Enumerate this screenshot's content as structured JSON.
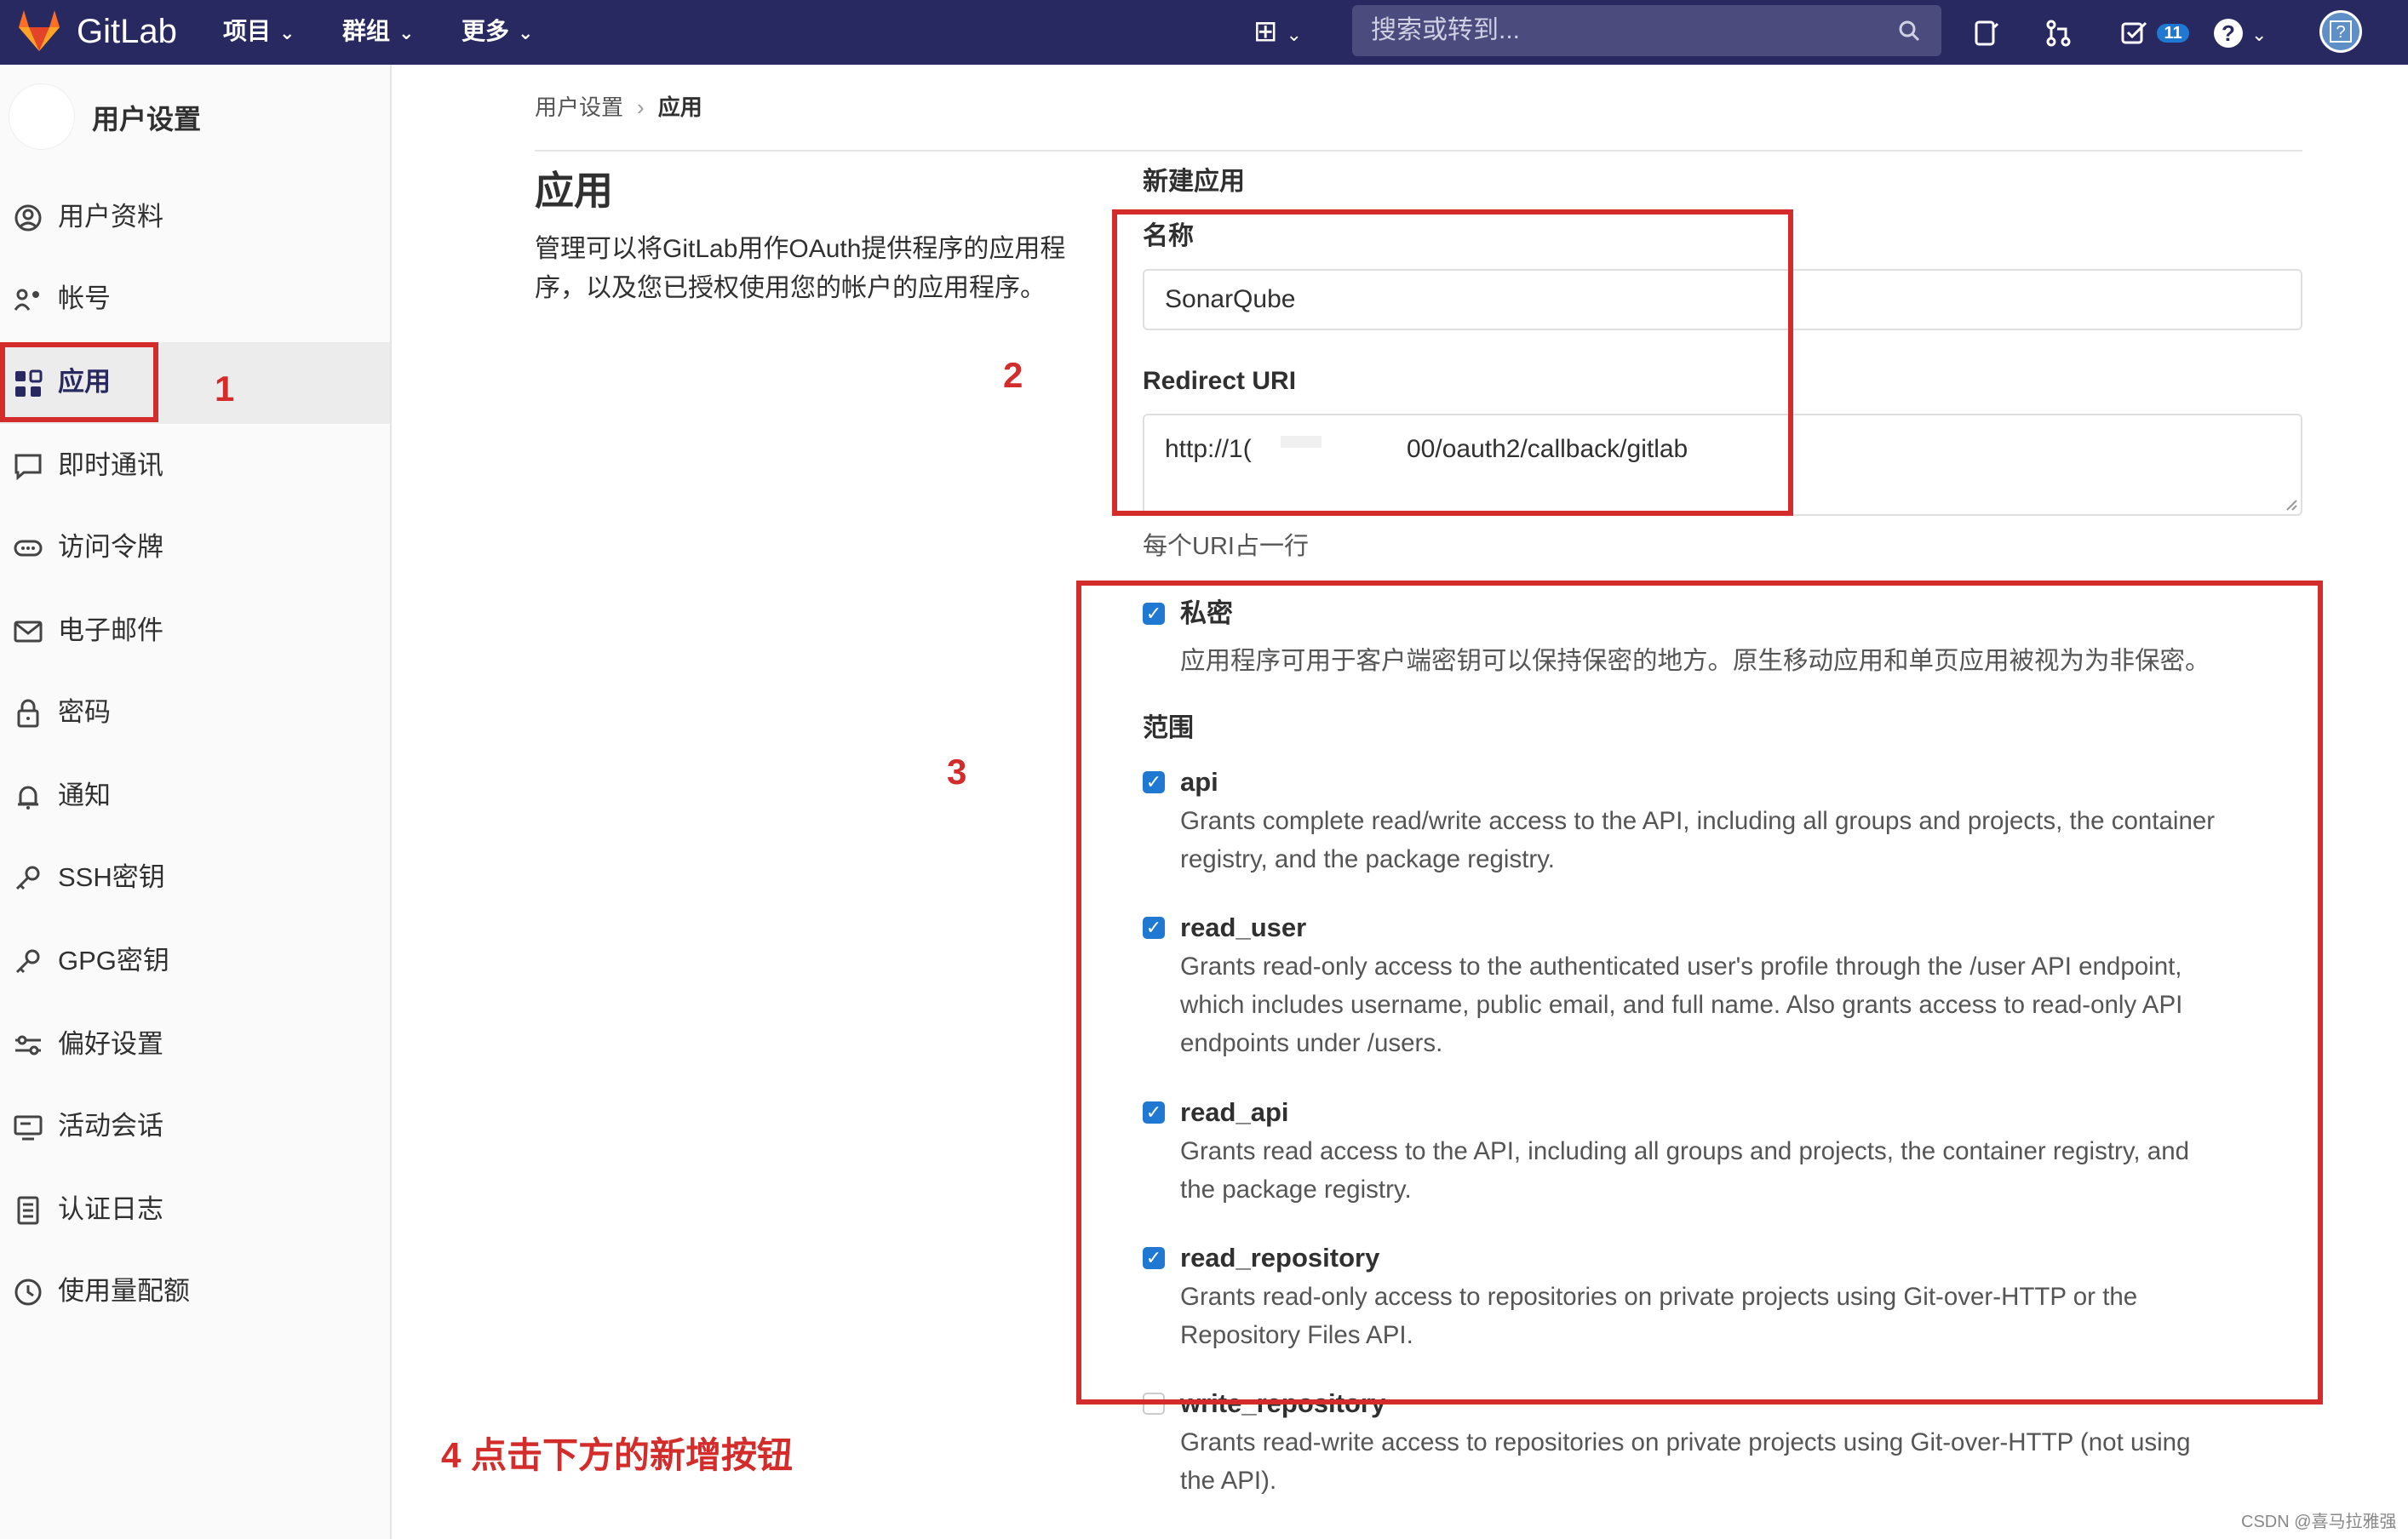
{
  "navbar": {
    "brand": "GitLab",
    "menus": [
      {
        "label": "项目"
      },
      {
        "label": "群组"
      },
      {
        "label": "更多"
      }
    ],
    "search_placeholder": "搜索或转到...",
    "todo_count": "11"
  },
  "sidebar": {
    "title": "用户设置",
    "items": [
      {
        "label": "用户资料",
        "icon": "profile-icon"
      },
      {
        "label": "帐号",
        "icon": "account-icon"
      },
      {
        "label": "应用",
        "icon": "applications-icon",
        "active": true
      },
      {
        "label": "即时通讯",
        "icon": "chat-icon"
      },
      {
        "label": "访问令牌",
        "icon": "token-icon"
      },
      {
        "label": "电子邮件",
        "icon": "mail-icon"
      },
      {
        "label": "密码",
        "icon": "lock-icon"
      },
      {
        "label": "通知",
        "icon": "bell-icon"
      },
      {
        "label": "SSH密钥",
        "icon": "key-icon"
      },
      {
        "label": "GPG密钥",
        "icon": "key-icon"
      },
      {
        "label": "偏好设置",
        "icon": "preferences-icon"
      },
      {
        "label": "活动会话",
        "icon": "monitor-icon"
      },
      {
        "label": "认证日志",
        "icon": "log-icon"
      },
      {
        "label": "使用量配额",
        "icon": "quota-icon"
      }
    ]
  },
  "breadcrumb": {
    "parent": "用户设置",
    "separator": "›",
    "current": "应用"
  },
  "page": {
    "title": "应用",
    "description": "管理可以将GitLab用作OAuth提供程序的应用程序，以及您已授权使用您的帐户的应用程序。"
  },
  "form": {
    "heading": "新建应用",
    "name_label": "名称",
    "name_value": "SonarQube",
    "redirect_label": "Redirect URI",
    "redirect_value_start": "http://1(",
    "redirect_value_end": "00/oauth2/callback/gitlab",
    "redirect_help": "每个URI占一行",
    "confidential_label": "私密",
    "confidential_checked": true,
    "confidential_desc": "应用程序可用于客户端密钥可以保持保密的地方。原生移动应用和单页应用被视为为非保密。",
    "scopes_label": "范围",
    "scopes": [
      {
        "name": "api",
        "checked": true,
        "desc_lines": [
          "Grants complete read/write access to the API, including all groups and projects, the container",
          "registry, and the package registry."
        ]
      },
      {
        "name": "read_user",
        "checked": true,
        "desc_lines": [
          "Grants read-only access to the authenticated user's profile through the /user API endpoint,",
          "which includes username, public email, and full name. Also grants access to read-only API",
          "endpoints under /users."
        ]
      },
      {
        "name": "read_api",
        "checked": true,
        "desc_lines": [
          "Grants read access to the API, including all groups and projects, the container registry, and",
          "the package registry."
        ]
      },
      {
        "name": "read_repository",
        "checked": true,
        "desc_lines": [
          "Grants read-only access to repositories on private projects using Git-over-HTTP or the",
          "Repository Files API."
        ]
      },
      {
        "name": "write_repository",
        "checked": false,
        "desc_lines": [
          "Grants read-write access to repositories on private projects using Git-over-HTTP (not using",
          "the API)."
        ]
      }
    ]
  },
  "annotations": {
    "step1": "1",
    "step2": "2",
    "step3": "3",
    "step4": "4 点击下方的新增按钮",
    "color": "#d42b2b"
  },
  "watermark": "CSDN @喜马拉雅强",
  "colors": {
    "navbar": "#292961",
    "accent": "#1f78d1",
    "annotation": "#d42b2b"
  }
}
